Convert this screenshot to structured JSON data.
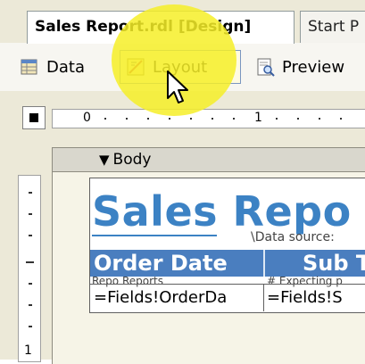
{
  "doc_tabs": [
    {
      "label": "Sales Report.rdl [Design]"
    },
    {
      "label": "Start P"
    }
  ],
  "view_tabs": {
    "data": "Data",
    "layout": "Layout",
    "preview": "Preview"
  },
  "ruler": {
    "h_labels": [
      "0",
      "1"
    ],
    "v_label": "1"
  },
  "band": {
    "label": "Body"
  },
  "report": {
    "title": "Sales Repo",
    "data_source_text": "\\Data source:",
    "headers": [
      "Order Date",
      "Sub T"
    ],
    "sub_header_text": "Repo Reports",
    "sub_header_text2": "# Expecting p",
    "cells": [
      "=Fields!OrderDa",
      "=Fields!S"
    ]
  },
  "colors": {
    "accent": "#3c82c4",
    "header_bg": "#4a7ebf",
    "highlight": "#f6ee28"
  }
}
